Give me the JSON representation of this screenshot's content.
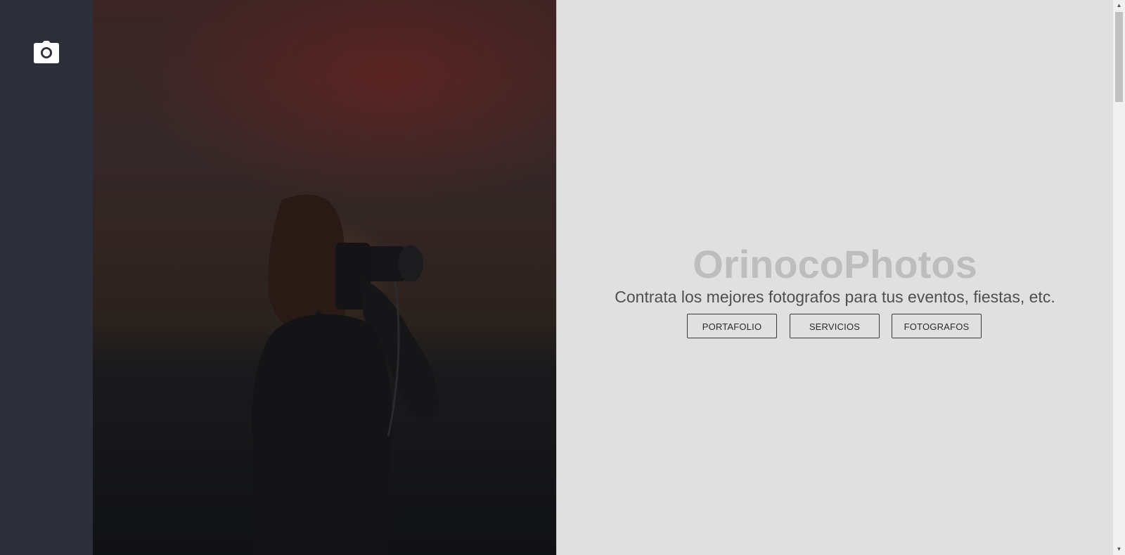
{
  "sidebar": {
    "logo_icon": "camera-icon",
    "color": "#2c2f37"
  },
  "hero": {
    "image": "photographer-silhouette-sunset"
  },
  "main": {
    "brand": "OrinocoPhotos",
    "tagline": "Contrata los mejores fotografos para tus eventos, fiestas, etc.",
    "buttons": [
      {
        "label": "PORTAFOLIO"
      },
      {
        "label": "SERVICIOS"
      },
      {
        "label": "FOTOGRAFOS"
      }
    ]
  },
  "scrollbar": {
    "up_icon": "scroll-up-arrow-icon",
    "down_icon": "scroll-down-arrow-icon"
  },
  "colors": {
    "background": "#e0e0e0",
    "brand": "#bdbdbd",
    "tagline": "#4e4e4e",
    "button_border": "#3a3a3a"
  }
}
